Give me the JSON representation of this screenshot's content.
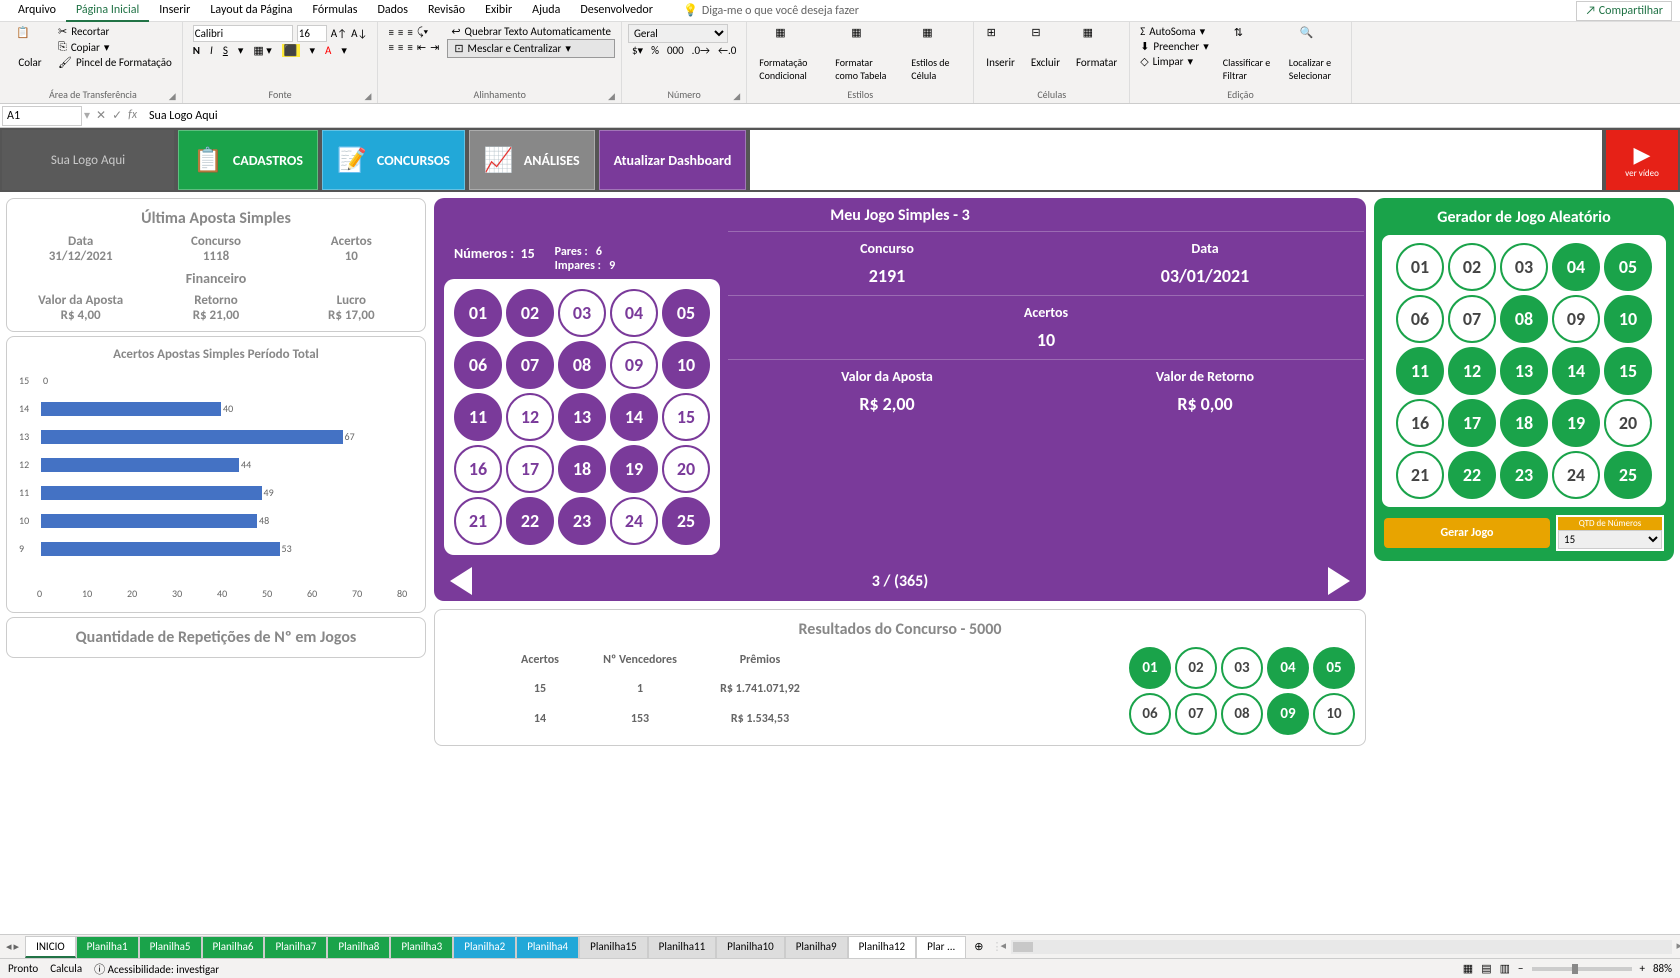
{
  "ribbonTabs": [
    "Arquivo",
    "Página Inicial",
    "Inserir",
    "Layout da Página",
    "Fórmulas",
    "Dados",
    "Revisão",
    "Exibir",
    "Ajuda",
    "Desenvolvedor"
  ],
  "tellMe": "Diga-me o que você deseja fazer",
  "share": "Compartilhar",
  "clipboard": {
    "paste": "Colar",
    "cut": "Recortar",
    "copy": "Copiar",
    "painter": "Pincel de Formatação",
    "group": "Área de Transferência"
  },
  "font": {
    "name": "Calibri",
    "size": "16",
    "group": "Fonte"
  },
  "align": {
    "wrap": "Quebrar Texto Automaticamente",
    "merge": "Mesclar e Centralizar",
    "group": "Alinhamento"
  },
  "number": {
    "format": "Geral",
    "group": "Número"
  },
  "styles": {
    "cond": "Formatação Condicional",
    "table": "Formatar como Tabela",
    "cell": "Estilos de Célula",
    "group": "Estilos"
  },
  "cells": {
    "insert": "Inserir",
    "delete": "Excluir",
    "format": "Formatar",
    "group": "Células"
  },
  "editing": {
    "sum": "AutoSoma",
    "fill": "Preencher",
    "clear": "Limpar",
    "sort": "Classificar e Filtrar",
    "find": "Localizar e Selecionar",
    "group": "Edição"
  },
  "nameBox": "A1",
  "formula": "Sua Logo Aqui",
  "logo": "Sua Logo Aqui",
  "btns": {
    "cadastros": "CADASTROS",
    "concursos": "CONCURSOS",
    "analises": "ANÁLISES",
    "atualizar": "Atualizar Dashboard",
    "video": "ver vídeo"
  },
  "ultima": {
    "title": "Última Aposta Simples",
    "dataLbl": "Data",
    "data": "31/12/2021",
    "concursoLbl": "Concurso",
    "concurso": "1118",
    "acertosLbl": "Acertos",
    "acertos": "10",
    "finTitle": "Financeiro",
    "valorLbl": "Valor da Aposta",
    "valor": "R$ 4,00",
    "retornoLbl": "Retorno",
    "retorno": "R$ 21,00",
    "lucroLbl": "Lucro",
    "lucro": "R$ 17,00"
  },
  "chart_data": {
    "type": "bar",
    "title": "Acertos Apostas Simples Período Total",
    "categories": [
      "15",
      "14",
      "13",
      "12",
      "11",
      "10",
      "9"
    ],
    "values": [
      0,
      40,
      67,
      44,
      49,
      48,
      53
    ],
    "xlim": [
      0,
      80
    ],
    "xlabel": "",
    "ylabel": ""
  },
  "quantTitle": "Quantidade de Repetições de Nº em Jogos",
  "jogo": {
    "title": "Meu Jogo Simples - 3",
    "numerosLbl": "Números :",
    "numeros": "15",
    "paresLbl": "Pares :",
    "pares": "6",
    "imparesLbl": "Impares :",
    "impares": "9",
    "concursoLbl": "Concurso",
    "concurso": "2191",
    "dataLbl": "Data",
    "data": "03/01/2021",
    "acertosLbl": "Acertos",
    "acertos": "10",
    "valorLbl": "Valor da Aposta",
    "valor": "R$ 2,00",
    "retornoLbl": "Valor de Retorno",
    "retorno": "R$ 0,00",
    "nav": "3 / (365)",
    "selected": [
      1,
      2,
      5,
      6,
      7,
      8,
      10,
      11,
      13,
      14,
      18,
      19,
      22,
      23,
      25
    ]
  },
  "gerador": {
    "title": "Gerador de Jogo Aleatório",
    "btn": "Gerar Jogo",
    "qtdLbl": "QTD de Números",
    "qtd": "15",
    "selected": [
      4,
      5,
      8,
      10,
      11,
      12,
      13,
      14,
      15,
      17,
      18,
      19,
      22,
      23,
      25
    ]
  },
  "results": {
    "title": "Resultados do Concurso - 5000",
    "hdr": [
      "Acertos",
      "Nº Vencedores",
      "Prêmios"
    ],
    "rows": [
      [
        "15",
        "1",
        "R$ 1.741.071,92"
      ],
      [
        "14",
        "153",
        "R$ 1.534,53"
      ]
    ],
    "selected": [
      1,
      4,
      5,
      9
    ]
  },
  "sheets": [
    {
      "name": "INICIO",
      "cls": "active"
    },
    {
      "name": "Planilha1",
      "cls": "green"
    },
    {
      "name": "Planilha5",
      "cls": "green"
    },
    {
      "name": "Planilha6",
      "cls": "green"
    },
    {
      "name": "Planilha7",
      "cls": "green"
    },
    {
      "name": "Planilha8",
      "cls": "green"
    },
    {
      "name": "Planilha3",
      "cls": "green"
    },
    {
      "name": "Planilha2",
      "cls": "blue"
    },
    {
      "name": "Planilha4",
      "cls": "blue"
    },
    {
      "name": "Planilha15",
      "cls": "gray"
    },
    {
      "name": "Planilha11",
      "cls": "gray"
    },
    {
      "name": "Planilha10",
      "cls": "gray"
    },
    {
      "name": "Planilha9",
      "cls": "gray"
    },
    {
      "name": "Planilha12",
      "cls": ""
    },
    {
      "name": "Plar ...",
      "cls": ""
    }
  ],
  "status": {
    "ready": "Pronto",
    "calc": "Calcula",
    "access": "Acessibilidade: investigar",
    "zoom": "88%"
  }
}
